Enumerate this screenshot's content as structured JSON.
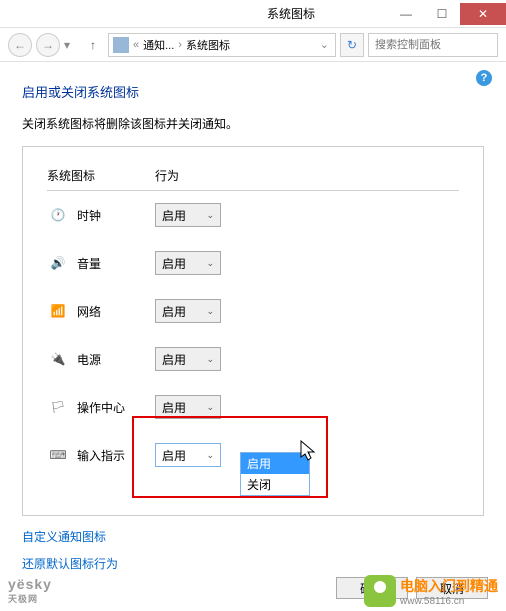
{
  "window": {
    "title": "系统图标"
  },
  "nav": {
    "breadcrumb": {
      "item1": "通知...",
      "item2": "系统图标"
    },
    "search_placeholder": "搜索控制面板"
  },
  "page": {
    "title": "启用或关闭系统图标",
    "description": "关闭系统图标将删除该图标并关闭通知。"
  },
  "table": {
    "header_icon": "系统图标",
    "header_behavior": "行为"
  },
  "rows": [
    {
      "label": "时钟",
      "value": "启用"
    },
    {
      "label": "音量",
      "value": "启用"
    },
    {
      "label": "网络",
      "value": "启用"
    },
    {
      "label": "电源",
      "value": "启用"
    },
    {
      "label": "操作中心",
      "value": "启用"
    },
    {
      "label": "输入指示",
      "value": "启用"
    }
  ],
  "dropdown": {
    "opt1": "启用",
    "opt2": "关闭"
  },
  "links": {
    "customize": "自定义通知图标",
    "restore": "还原默认图标行为"
  },
  "buttons": {
    "ok": "确定",
    "cancel": "取消"
  },
  "watermark": {
    "left": "yësky",
    "left_sub": "天极网",
    "right": "电脑入门到精通",
    "right_url": "www.58116.cn"
  }
}
